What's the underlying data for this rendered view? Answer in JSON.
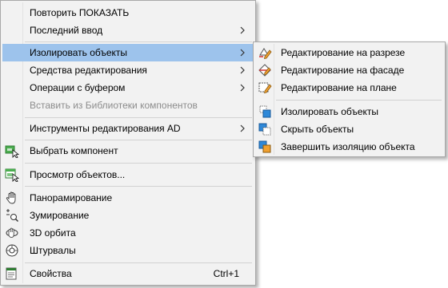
{
  "main_menu": {
    "items": [
      {
        "label": "Повторить ПОКАЗАТЬ"
      },
      {
        "label": "Последний ввод"
      },
      {
        "label": "Изолировать объекты"
      },
      {
        "label": "Средства редактирования"
      },
      {
        "label": "Операции с буфером"
      },
      {
        "label": "Вставить из Библиотеки компонентов"
      },
      {
        "label": "Инструменты редактирования AD"
      },
      {
        "label": "Выбрать компонент"
      },
      {
        "label": "Просмотр объектов..."
      },
      {
        "label": "Панорамирование"
      },
      {
        "label": "Зумирование"
      },
      {
        "label": "3D орбита"
      },
      {
        "label": "Штурвалы"
      },
      {
        "label": "Свойства",
        "shortcut": "Ctrl+1"
      }
    ]
  },
  "sub_menu": {
    "items": [
      {
        "label": "Редактирование на разрезе",
        "icon": "edit-section-icon"
      },
      {
        "label": "Редактирование на фасаде",
        "icon": "edit-elevation-icon"
      },
      {
        "label": "Редактирование на плане",
        "icon": "edit-plan-icon"
      },
      {
        "label": "Изолировать объекты",
        "icon": "isolate-objects-icon"
      },
      {
        "label": "Скрыть объекты",
        "icon": "hide-objects-icon"
      },
      {
        "label": "Завершить изоляцию объекта",
        "icon": "end-isolation-icon"
      }
    ]
  },
  "colors": {
    "menu_background": "#f2f2f2",
    "highlight": "#9dc3ec",
    "disabled_text": "#8c8c8c"
  }
}
